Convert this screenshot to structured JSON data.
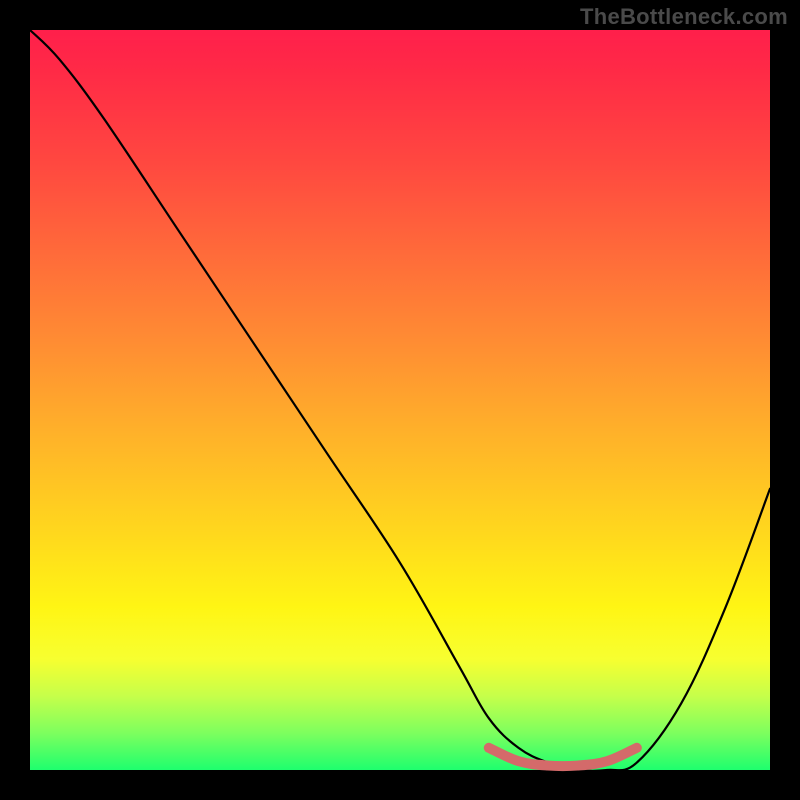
{
  "watermark": "TheBottleneck.com",
  "chart_data": {
    "type": "line",
    "title": "",
    "xlabel": "",
    "ylabel": "",
    "xlim": [
      0,
      100
    ],
    "ylim": [
      0,
      100
    ],
    "series": [
      {
        "name": "bottleneck-curve",
        "color": "#000000",
        "x": [
          0,
          4,
          10,
          20,
          30,
          40,
          50,
          58,
          62,
          66,
          70,
          74,
          78,
          82,
          88,
          94,
          100
        ],
        "values": [
          100,
          96,
          88,
          73,
          58,
          43,
          28,
          14,
          7,
          3,
          1,
          0,
          0,
          1,
          9,
          22,
          38
        ]
      },
      {
        "name": "highlight-band",
        "color": "#d46a6a",
        "x": [
          62,
          66,
          70,
          74,
          78,
          82
        ],
        "values": [
          3,
          1.2,
          0.6,
          0.6,
          1.2,
          3
        ]
      }
    ],
    "gradient_stops": [
      {
        "pos": 0,
        "color": "#ff1f4b"
      },
      {
        "pos": 18,
        "color": "#ff4840"
      },
      {
        "pos": 42,
        "color": "#ff8c33"
      },
      {
        "pos": 66,
        "color": "#ffd21f"
      },
      {
        "pos": 85,
        "color": "#f7ff30"
      },
      {
        "pos": 100,
        "color": "#1eff6e"
      }
    ]
  }
}
